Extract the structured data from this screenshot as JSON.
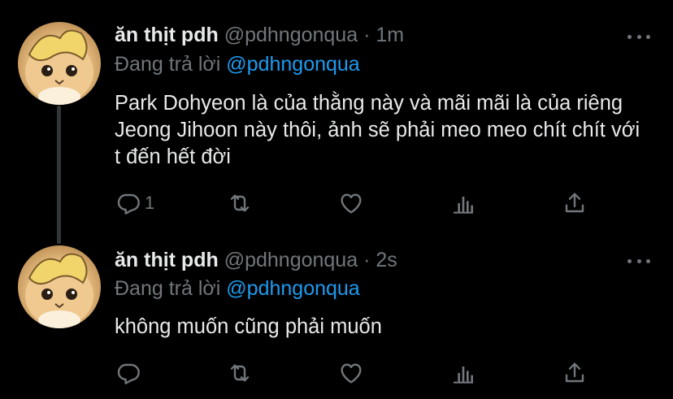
{
  "colors": {
    "background": "#000000",
    "text": "#e7e9ea",
    "muted": "#71767b",
    "link": "#1d9bf0",
    "thread_line": "#333639"
  },
  "tweets": [
    {
      "display_name": "ăn thịt pdh",
      "handle": "@pdhngonqua",
      "sep": "·",
      "time": "1m",
      "reply_prefix": "Đang trả lời",
      "reply_to": "@pdhngonqua",
      "text": "Park Dohyeon là của thằng này và mãi mãi là của riêng Jeong Jihoon này thôi, ảnh sẽ phải meo meo chít chít với t đến hết đời",
      "reply_count": "1",
      "icons": [
        "reply-icon",
        "retweet-icon",
        "like-icon",
        "analytics-icon",
        "share-icon",
        "more-icon"
      ]
    },
    {
      "display_name": "ăn thịt pdh",
      "handle": "@pdhngonqua",
      "sep": "·",
      "time": "2s",
      "reply_prefix": "Đang trả lời",
      "reply_to": "@pdhngonqua",
      "text": "không muốn cũng phải muốn",
      "reply_count": "",
      "icons": [
        "reply-icon",
        "retweet-icon",
        "like-icon",
        "analytics-icon",
        "share-icon",
        "more-icon"
      ]
    }
  ]
}
